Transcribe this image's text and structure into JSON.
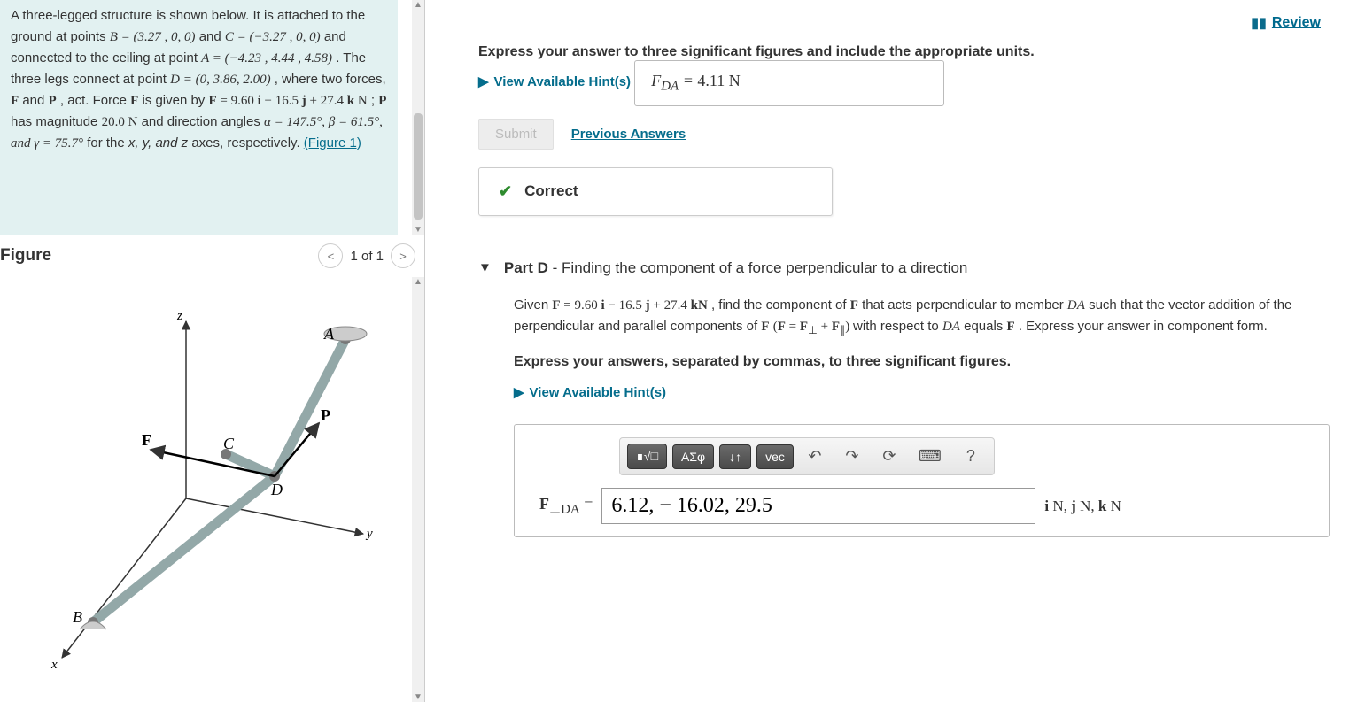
{
  "review_link": "Review",
  "problem": {
    "intro": "A three-legged structure is shown below. It is attached to the ground at points ",
    "B": "B = (3.27 , 0, 0)",
    "mid1": " and ",
    "C": "C = (−3.27 , 0, 0)",
    "mid2": " and connected to the ceiling at point ",
    "A": "A = (−4.23 , 4.44 , 4.58)",
    "mid3": ". The three legs connect at point ",
    "D": "D = (0, 3.86, 2.00)",
    "mid4": ", where two forces, ",
    "F_label": "F",
    "and": " and ",
    "P_label": "P",
    "mid5": ", act. Force ",
    "mid6": " is given by ",
    "F_eqn": "F = 9.60 i − 16.5 j + 27.4 k N",
    "mid7": "; ",
    "mid8": " has magnitude ",
    "Pmag": "20.0 N",
    "mid9": " and direction angles ",
    "angles": "α = 147.5°, β = 61.5°, and γ = 75.7°",
    "mid10": " for the ",
    "axes": "x, y, and z",
    "mid11": " axes, respectively.",
    "fig_link": "(Figure 1)"
  },
  "figure": {
    "title": "Figure",
    "pager": "1 of 1"
  },
  "partC": {
    "instruction": "Express your answer to three significant figures and include the appropriate units.",
    "hints": "View Available Hint(s)",
    "label_html": "F_DA =",
    "answer": "4.11 N",
    "submit": "Submit",
    "prev": "Previous Answers",
    "correct": "Correct"
  },
  "partD": {
    "label": "Part D",
    "title": " - Finding the component of a force perpendicular to a direction",
    "body1": "Given ",
    "F_eqn": "F = 9.60 i − 16.5 j + 27.4 kN",
    "body2": ", find the component of ",
    "body3": " that acts perpendicular to member ",
    "DA": "DA",
    "body4": " such that the vector addition of the perpendicular and parallel components of ",
    "paren": "(F = F⊥ + F∥)",
    "body5": " with respect to ",
    "body6": " equals ",
    "body7": ". Express your answer in component form.",
    "instruction": "Express your answers, separated by commas, to three significant figures.",
    "hints": "View Available Hint(s)",
    "toolbar": {
      "b1": "∎√□",
      "b2": "ΑΣφ",
      "b3": "↓↑",
      "b4": "vec",
      "undo": "↶",
      "redo": "↷",
      "reset": "⟳",
      "keyboard": "⌨",
      "help": "?"
    },
    "ans_label": "F⊥DA =",
    "ans_value": "6.12, − 16.02, 29.5",
    "units": "i N, j N, k N"
  }
}
